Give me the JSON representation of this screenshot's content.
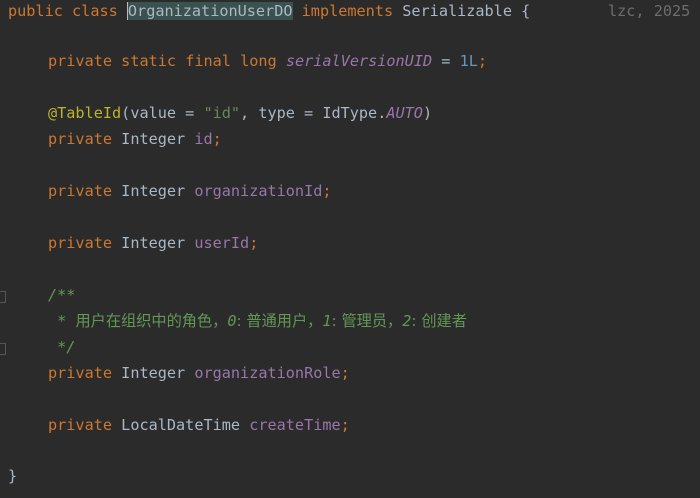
{
  "code": {
    "public": "public",
    "class": "class",
    "class_name": "OrganizationUserDO",
    "implements": "implements",
    "interface": "Serializable",
    "open_brace": "{",
    "close_brace": "}",
    "private": "private",
    "static": "static",
    "final": "final",
    "long": "long",
    "serial_field": "serialVersionUID",
    "equals": " = ",
    "serial_value": "1L",
    "semicolon": ";",
    "annotation": "@TableId",
    "anno_open": "(",
    "anno_value_key": "value = ",
    "anno_value": "\"id\"",
    "anno_sep": ", type = ",
    "anno_type_class": "IdType.",
    "anno_type_enum": "AUTO",
    "anno_close": ")",
    "type_integer": "Integer",
    "type_datetime": "LocalDateTime",
    "field_id": "id",
    "field_org_id": "organizationId",
    "field_user_id": "userId",
    "field_org_role": "organizationRole",
    "field_create_time": "createTime",
    "doc_open": "/**",
    "doc_star": " * ",
    "doc_text_1": "用户在组织中的角色，",
    "doc_num_0": "0",
    "doc_text_2": ": 普通用户，",
    "doc_num_1": "1",
    "doc_text_3": ": 管理员，",
    "doc_num_2": "2",
    "doc_text_4": ": 创建者",
    "doc_close": " */"
  },
  "author_hint": "lzc, 2025"
}
